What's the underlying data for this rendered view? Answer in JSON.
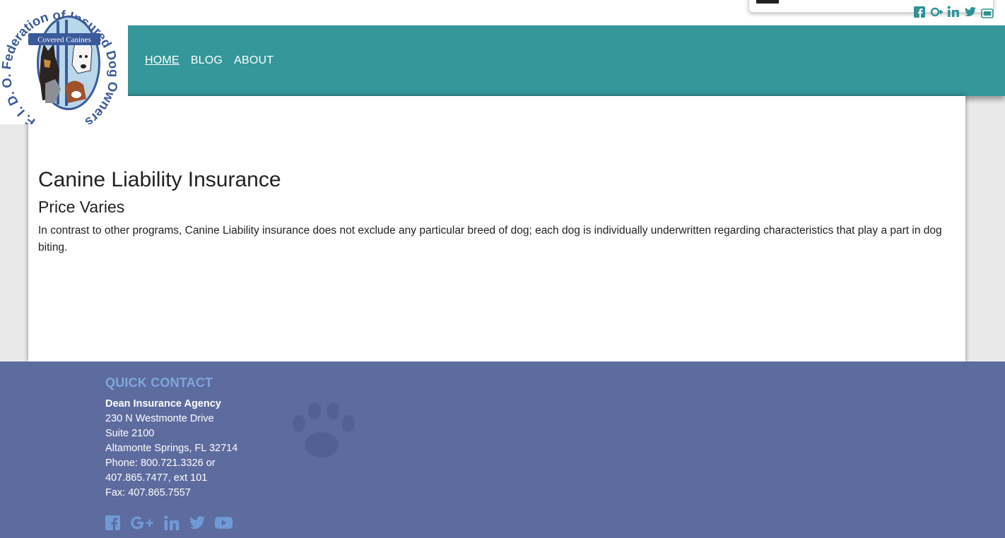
{
  "logo": {
    "ring_text": "F. I. D. O. Federation of Insured Dog Owners, Inc.",
    "banner_text": "Covered Canines"
  },
  "nav": {
    "items": [
      {
        "label": "HOME",
        "active": true
      },
      {
        "label": "BLOG",
        "active": false
      },
      {
        "label": "ABOUT",
        "active": false
      }
    ]
  },
  "main": {
    "title": "Canine Liability Insurance",
    "subtitle": "Price Varies",
    "description": "In contrast to other programs, Canine Liability insurance does not exclude any particular breed of dog; each dog is individually underwritten regarding characteristics that play a part in dog biting."
  },
  "footer": {
    "heading": "QUICK CONTACT",
    "agency": "Dean Insurance Agency",
    "address1": "230 N Westmonte Drive",
    "address2": "Suite 2100",
    "city": "Altamonte Springs, FL 32714",
    "phone": "Phone: 800.721.3326 or",
    "phone2": "407.865.7477, ext 101",
    "fax": "Fax: 407.865.7557"
  },
  "social": [
    "facebook-icon",
    "google-plus-icon",
    "linkedin-icon",
    "twitter-icon",
    "youtube-icon"
  ],
  "colors": {
    "nav_teal": "#34979a",
    "footer_blue": "#5d6b9e",
    "footer_heading": "#7fa7dc",
    "footer_icons": "#6f9ad6",
    "logo_blue": "#3b5a9b"
  }
}
